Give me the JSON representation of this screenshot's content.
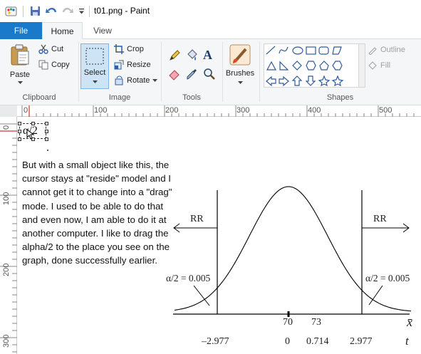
{
  "window": {
    "title": "t01.png - Paint"
  },
  "tabs": {
    "file": "File",
    "home": "Home",
    "view": "View"
  },
  "ribbon": {
    "clipboard": {
      "paste": "Paste",
      "cut": "Cut",
      "copy": "Copy",
      "group": "Clipboard"
    },
    "image": {
      "select": "Select",
      "crop": "Crop",
      "resize": "Resize",
      "rotate": "Rotate",
      "group": "Image"
    },
    "tools": {
      "group": "Tools",
      "text_tool_glyph": "A"
    },
    "brushes": {
      "label": "Brushes"
    },
    "shapes": {
      "group": "Shapes",
      "outline": "Outline",
      "fill": "Fill"
    }
  },
  "ruler": {
    "h_labels": [
      "0",
      "100",
      "200",
      "300",
      "400",
      "500"
    ],
    "v_labels": [
      "0",
      "100",
      "200",
      "300"
    ]
  },
  "canvas": {
    "selected_object": "α/2",
    "body_text": "But with a small object like this, the cursor stays at \"reside\" model and I cannot get it to change into a \"drag\" mode. I used to be able to do that and even now, I am able to do it at another computer. I like to drag the alpha/2 to the place you see on the graph, done successfully earlier."
  },
  "graph": {
    "rr_left": "RR",
    "rr_right": "RR",
    "alpha_left": "α/2 = 0.005",
    "alpha_right": "α/2 = 0.005",
    "xbar_ticks": [
      "70",
      "73"
    ],
    "xbar_symbol": "x̄",
    "t_values": [
      "–2.977",
      "0",
      "0.714",
      "2.977"
    ],
    "t_symbol": "t"
  }
}
